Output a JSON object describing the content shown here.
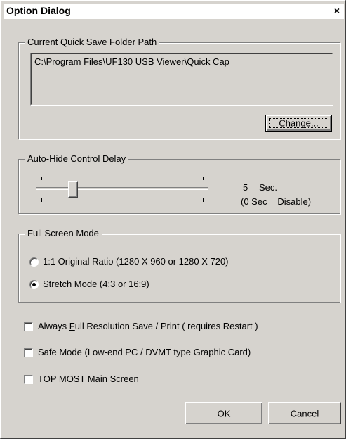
{
  "window": {
    "title": "Option Dialog",
    "close_glyph": "×"
  },
  "quick_save": {
    "legend": "Current Quick Save Folder Path",
    "path": "C:\\Program Files\\UF130 USB Viewer\\Quick Cap",
    "change_label": "Change..."
  },
  "auto_hide": {
    "legend": "Auto-Hide Control Delay",
    "value": "5",
    "unit": "Sec.",
    "note": "(0 Sec = Disable)",
    "slider_position": 0.2
  },
  "full_screen": {
    "legend": "Full Screen Mode",
    "options": [
      {
        "label": "1:1 Original Ratio (1280 X 960 or 1280 X 720)",
        "selected": false
      },
      {
        "label": "Stretch Mode (4:3 or 16:9)",
        "selected": true
      }
    ]
  },
  "checkboxes": [
    {
      "prefix": "Always ",
      "accel": "F",
      "rest": "ull Resolution Save / Print  ( requires Restart )",
      "checked": false
    },
    {
      "prefix": "",
      "accel": "",
      "rest": "Safe Mode (Low-end PC / DVMT type Graphic Card)",
      "checked": false
    },
    {
      "prefix": "",
      "accel": "",
      "rest": "TOP MOST Main Screen",
      "checked": false
    }
  ],
  "buttons": {
    "ok": "OK",
    "cancel": "Cancel"
  },
  "colors": {
    "face": "#d6d3ce",
    "titlebar": "#ffffff"
  }
}
